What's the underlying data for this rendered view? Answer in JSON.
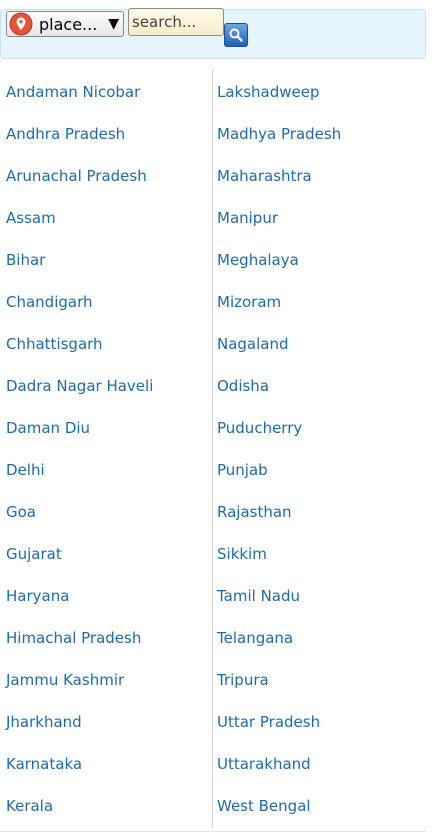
{
  "place_select": {
    "label": "place...",
    "caret": "▼",
    "icon": "location-pin-icon"
  },
  "search": {
    "placeholder": "search...",
    "value": "",
    "button_icon": "magnifier-icon"
  },
  "colors": {
    "link": "#1f6aa8",
    "topbar": "#e6f4fc",
    "pin": "#e2553a"
  },
  "states_left": [
    "Andaman Nicobar",
    "Andhra Pradesh",
    "Arunachal Pradesh",
    "Assam",
    "Bihar",
    "Chandigarh",
    "Chhattisgarh",
    "Dadra Nagar Haveli",
    "Daman Diu",
    "Delhi",
    "Goa",
    "Gujarat",
    "Haryana",
    "Himachal Pradesh",
    "Jammu Kashmir",
    "Jharkhand",
    "Karnataka",
    "Kerala"
  ],
  "states_right": [
    "Lakshadweep",
    "Madhya Pradesh",
    "Maharashtra",
    "Manipur",
    "Meghalaya",
    "Mizoram",
    "Nagaland",
    "Odisha",
    "Puducherry",
    "Punjab",
    "Rajasthan",
    "Sikkim",
    "Tamil Nadu",
    "Telangana",
    "Tripura",
    "Uttar Pradesh",
    "Uttarakhand",
    "West Bengal"
  ]
}
